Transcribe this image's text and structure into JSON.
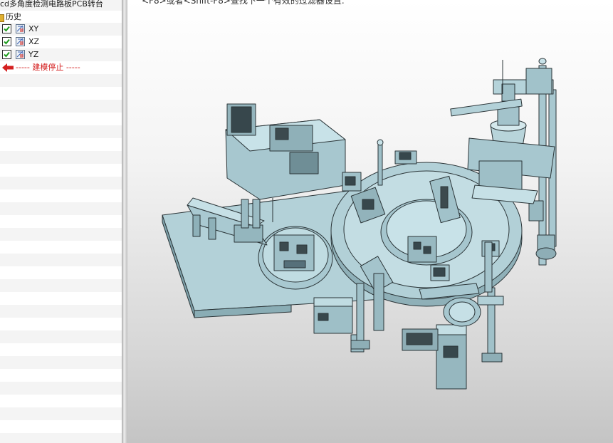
{
  "tree": {
    "title": "cd多角度检测电路板PCB转台",
    "history_label": "历史",
    "planes": [
      {
        "label": "XY",
        "checked": true
      },
      {
        "label": "XZ",
        "checked": true
      },
      {
        "label": "YZ",
        "checked": true
      }
    ],
    "stop_marker": "----- 建模停止 -----"
  },
  "viewport": {
    "hint": "<F8>或者<Shift-F8>查找下一个有效的过滤器设置."
  },
  "colors": {
    "model_fill": "#b5d3da",
    "model_dark": "#6e8e96",
    "model_line": "#2b3538",
    "arrow_red": "#d42020"
  }
}
